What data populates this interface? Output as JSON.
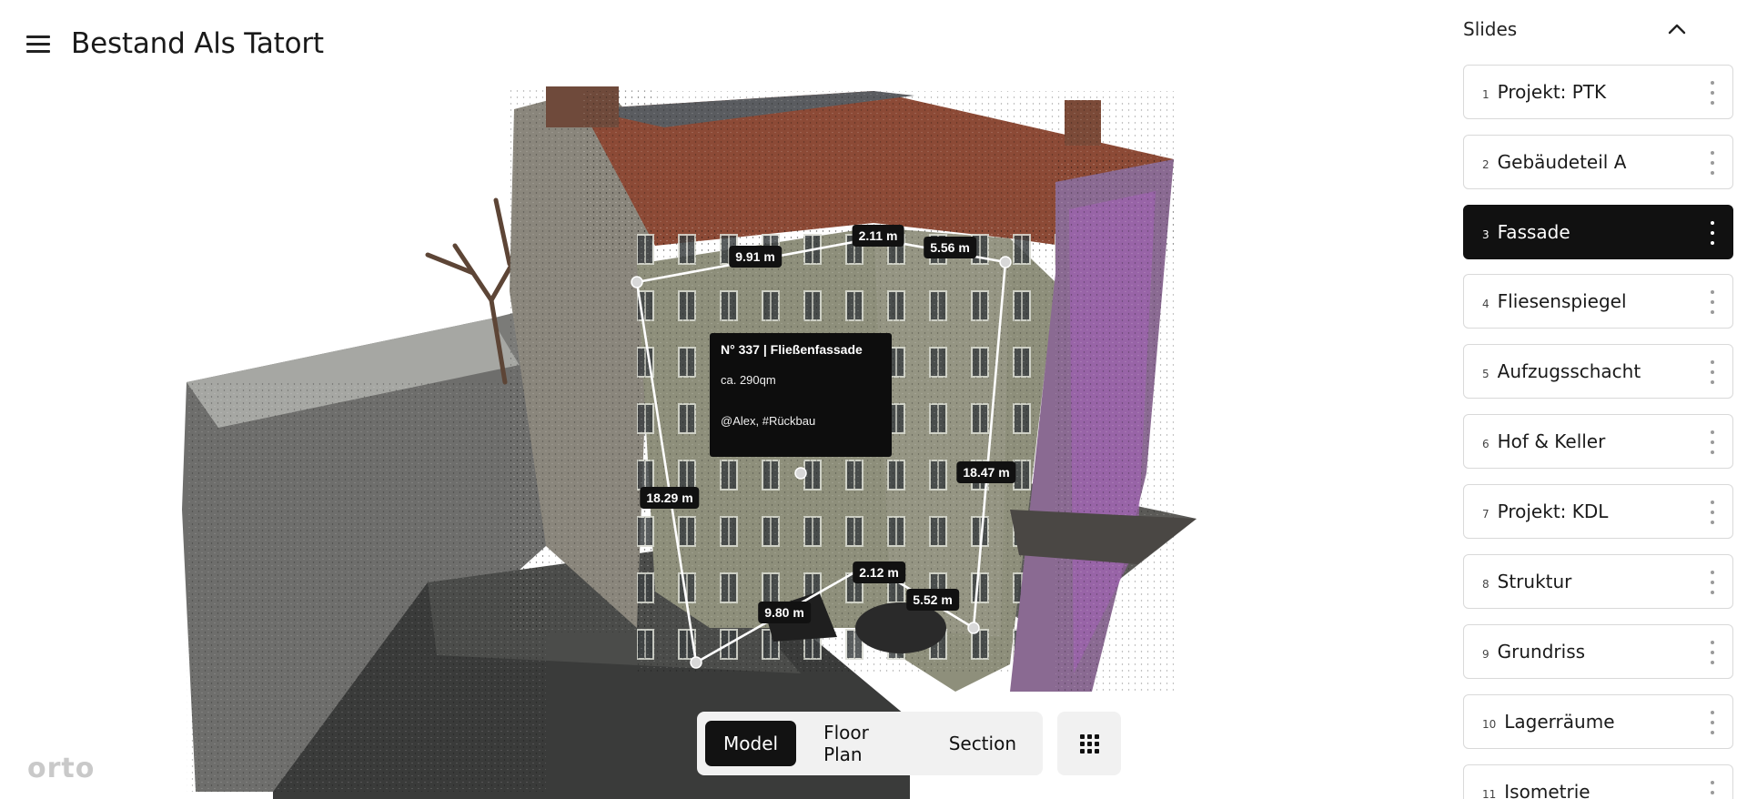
{
  "header": {
    "title": "Bestand Als Tatort",
    "menu_icon": "hamburger-menu-icon"
  },
  "viewport": {
    "measurements": [
      "9.91 m",
      "2.11 m",
      "5.56 m",
      "18.29 m",
      "18.47 m",
      "2.12 m",
      "9.80 m",
      "5.52 m"
    ],
    "annotation": {
      "title": "N° 337 | Fließenfassade",
      "area": "ca. 290qm",
      "tags": "@Alex, #Rückbau"
    }
  },
  "logo": "orto",
  "view_toolbar": {
    "tabs": [
      {
        "label": "Model",
        "active": true
      },
      {
        "label": "Floor Plan",
        "active": false
      },
      {
        "label": "Section",
        "active": false
      }
    ],
    "grid_icon": "grid-dots-icon"
  },
  "slides": {
    "title": "Slides",
    "collapse_icon": "chevron-up-icon",
    "items": [
      {
        "num": "1",
        "label": "Projekt: PTK",
        "active": false
      },
      {
        "num": "2",
        "label": "Gebäudeteil A",
        "active": false
      },
      {
        "num": "3",
        "label": "Fassade",
        "active": true
      },
      {
        "num": "4",
        "label": "Fliesenspiegel",
        "active": false
      },
      {
        "num": "5",
        "label": "Aufzugsschacht",
        "active": false
      },
      {
        "num": "6",
        "label": "Hof & Keller",
        "active": false
      },
      {
        "num": "7",
        "label": "Projekt: KDL",
        "active": false
      },
      {
        "num": "8",
        "label": "Struktur",
        "active": false
      },
      {
        "num": "9",
        "label": "Grundriss",
        "active": false
      },
      {
        "num": "10",
        "label": "Lagerräume",
        "active": false
      },
      {
        "num": "11",
        "label": "Isometrie",
        "active": false
      }
    ]
  },
  "colors": {
    "accent_dark": "#111111",
    "toolbar_bg": "#f1f1f1",
    "roof": "#8a4a36",
    "facade": "#8d8f7a"
  }
}
